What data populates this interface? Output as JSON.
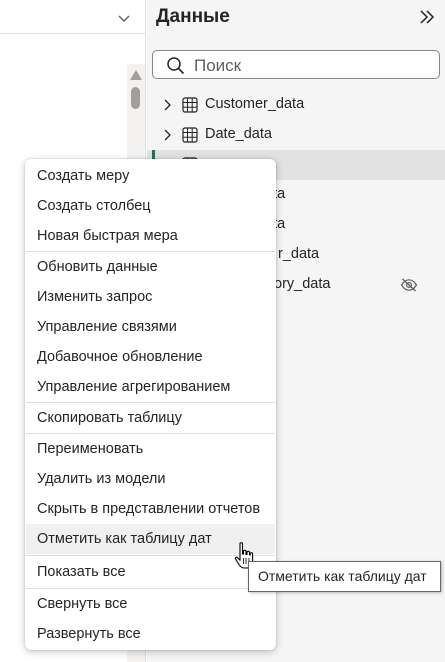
{
  "data_pane": {
    "title": "Данные",
    "search_placeholder": "Поиск",
    "tables": [
      {
        "label": "Customer_data",
        "selected": false,
        "hidden": false
      },
      {
        "label": "Date_data",
        "selected": false,
        "hidden": false
      },
      {
        "label": "",
        "selected": true,
        "hidden": false
      },
      {
        "label": "data",
        "selected": false,
        "hidden": false
      },
      {
        "label": "data",
        "selected": false,
        "hidden": false
      },
      {
        "label": "r_data",
        "selected": false,
        "hidden": false
      },
      {
        "label": "ory_data",
        "selected": false,
        "hidden": true
      }
    ]
  },
  "context_menu": {
    "items": [
      {
        "label": "Создать меру"
      },
      {
        "label": "Создать столбец"
      },
      {
        "label": "Новая быстрая мера"
      },
      {
        "label": "Обновить данные"
      },
      {
        "label": "Изменить запрос"
      },
      {
        "label": "Управление связями"
      },
      {
        "label": "Добавочное обновление"
      },
      {
        "label": "Управление агрегированием"
      },
      {
        "label": "Скопировать таблицу"
      },
      {
        "label": "Переименовать"
      },
      {
        "label": "Удалить из модели"
      },
      {
        "label": "Скрыть в представлении отчетов"
      },
      {
        "label": "Отметить как таблицу дат",
        "hovered": true
      },
      {
        "label": "Показать все"
      },
      {
        "label": "Свернуть все"
      },
      {
        "label": "Развернуть все"
      }
    ]
  },
  "tooltip": {
    "text": "Отметить как таблицу дат"
  },
  "colors": {
    "accent": "#117865",
    "pane_bg": "#f5f5f5",
    "selected_row": "#e1e1e1",
    "menu_hover": "#f0f0f0"
  },
  "icons": [
    "chevron-down-icon",
    "scroll-up-icon",
    "expand-pane-icon",
    "search-icon",
    "chevron-right-icon",
    "table-icon",
    "hidden-eye-icon",
    "hand-cursor-icon"
  ]
}
